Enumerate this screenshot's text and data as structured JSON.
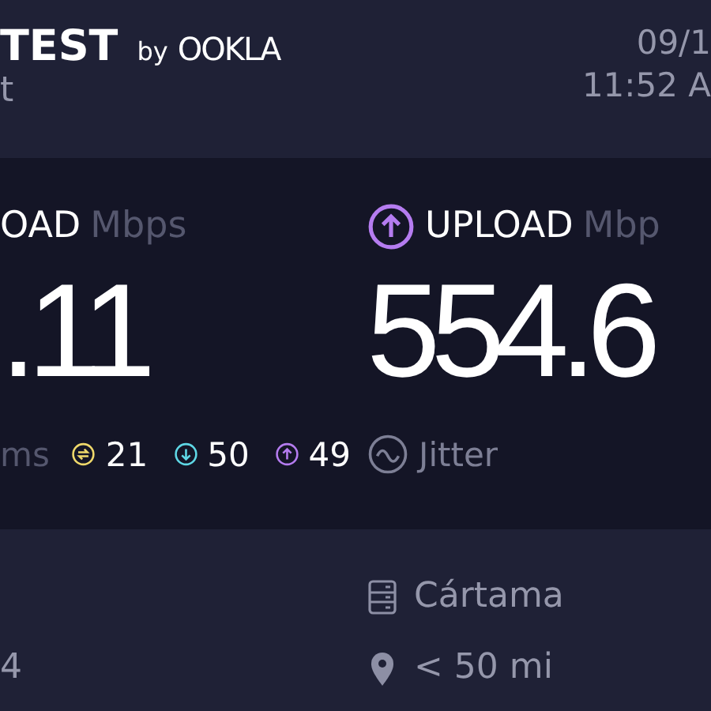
{
  "header": {
    "logo": {
      "brand": "TEST",
      "by": "by",
      "company": "OOKLA"
    },
    "subtitle": "t",
    "date": "09/1",
    "time": "11:52 A"
  },
  "results": [
    {
      "kind": "download",
      "label": "OAD",
      "unit": "Mbps",
      "value": ".11"
    },
    {
      "kind": "upload",
      "label": "UPLOAD",
      "unit": "Mbp",
      "value": "554.6"
    }
  ],
  "ping": {
    "unit": "ms",
    "items": [
      {
        "kind": "idle",
        "color": "#f0d96b",
        "value": "21"
      },
      {
        "kind": "download",
        "color": "#5fd8e6",
        "value": "50"
      },
      {
        "kind": "upload",
        "color": "#b57cf0",
        "value": "49"
      }
    ]
  },
  "jitter": {
    "label": "Jitter"
  },
  "footer": {
    "left_value": "4",
    "server": "Cártama",
    "distance": "< 50 mi"
  }
}
